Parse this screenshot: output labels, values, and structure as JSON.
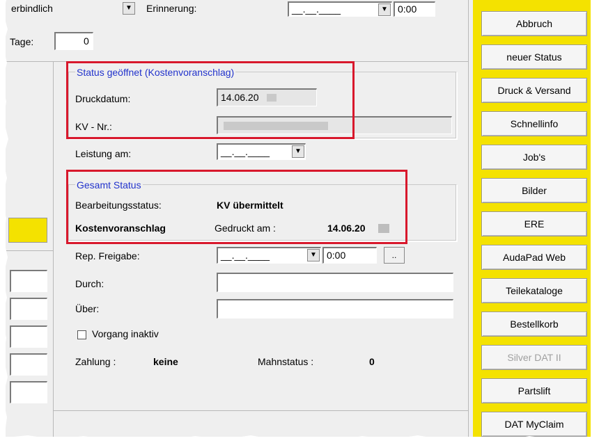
{
  "top_row": {
    "verbindlich_label": "erbindlich",
    "erinnerung_label": "Erinnerung:",
    "erinnerung_date": "__.__.____",
    "erinnerung_time": "0:00"
  },
  "tage": {
    "label": "Tage:",
    "value": "0"
  },
  "status_group": {
    "title": "Status geöffnet (Kostenvoranschlag)",
    "druckdatum_label": "Druckdatum:",
    "druckdatum_value": "14.06.20",
    "kv_nr_label": "KV - Nr.:"
  },
  "leistung": {
    "label": "Leistung am:",
    "value": "__.__.____"
  },
  "gesamt_group": {
    "title": "Gesamt Status",
    "bearbeitung_label": "Bearbeitungsstatus:",
    "bearbeitung_value": "KV übermittelt",
    "kostenvoranschlag_label": "Kostenvoranschlag",
    "gedruckt_label": "Gedruckt am :",
    "gedruckt_value": "14.06.20"
  },
  "rep_freigabe": {
    "label": "Rep. Freigabe:",
    "date": "__.__.____",
    "time": "0:00",
    "ellipsis": ".."
  },
  "durch": {
    "label": "Durch:",
    "value": ""
  },
  "ueber": {
    "label": "Über:",
    "value": ""
  },
  "vorgang_inaktiv": {
    "label": "Vorgang inaktiv",
    "checked": false
  },
  "zahlung": {
    "label": "Zahlung :",
    "value": "keine"
  },
  "mahnstatus": {
    "label": "Mahnstatus :",
    "value": "0"
  },
  "sidebar": {
    "buttons": [
      {
        "label": "Abbruch",
        "enabled": true
      },
      {
        "label": "neuer Status",
        "enabled": true
      },
      {
        "label": "Druck & Versand",
        "enabled": true
      },
      {
        "label": "Schnellinfo",
        "enabled": true
      },
      {
        "label": "Job's",
        "enabled": true
      },
      {
        "label": "Bilder",
        "enabled": true
      },
      {
        "label": "ERE",
        "enabled": true
      },
      {
        "label": "AudaPad Web",
        "enabled": true
      },
      {
        "label": "Teilekataloge",
        "enabled": true
      },
      {
        "label": "Bestellkorb",
        "enabled": true
      },
      {
        "label": "Silver DAT II",
        "enabled": false
      },
      {
        "label": "Partslift",
        "enabled": true
      },
      {
        "label": "DAT MyClaim",
        "enabled": true
      }
    ]
  },
  "colors": {
    "highlight_red": "#d8182c",
    "sidebar_yellow": "#f4e200",
    "group_title_blue": "#2233cc"
  }
}
